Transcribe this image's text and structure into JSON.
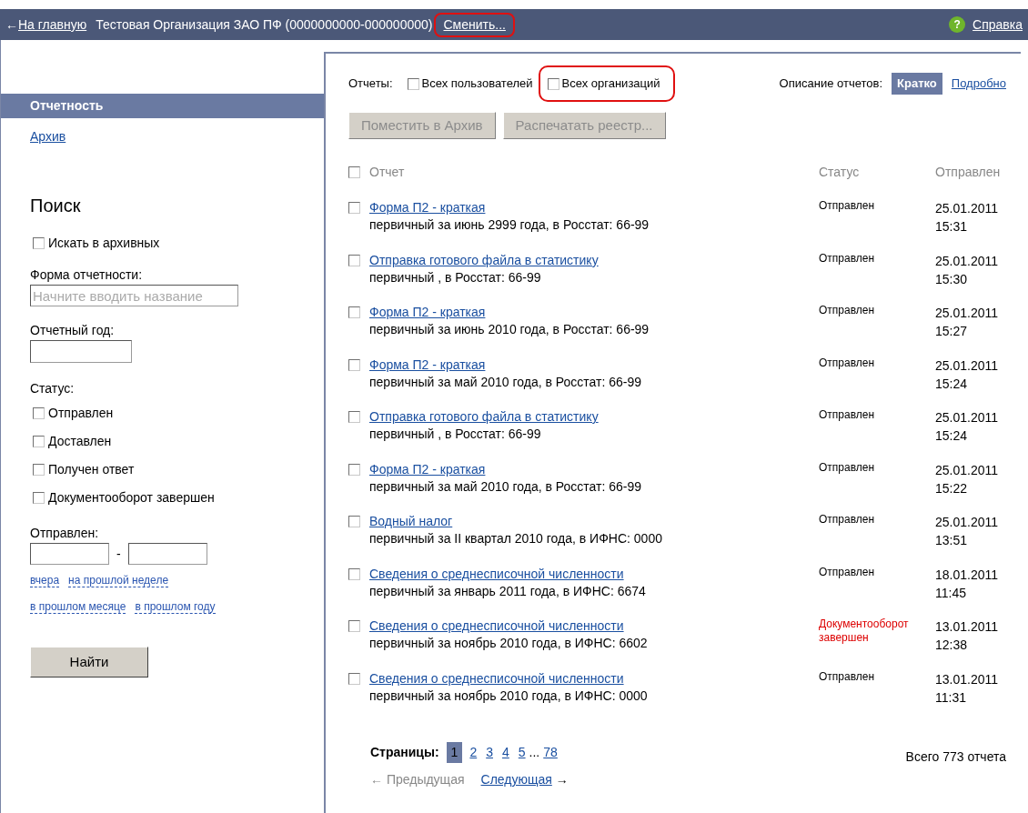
{
  "top_bar": {
    "home_link": "На главную",
    "home_arrow": "←",
    "organization": "Тестовая Организация ЗАО ПФ (0000000000-000000000)",
    "change_link": "Сменить...",
    "help_icon": "?",
    "help_link": "Справка"
  },
  "sidebar": {
    "items": [
      {
        "label": "Отчетность",
        "selected": true
      },
      {
        "label": "Архив",
        "selected": false
      }
    ]
  },
  "search": {
    "title": "Поиск",
    "archive_checkbox": {
      "label": "Искать в архивных",
      "checked": false
    },
    "form_label": "Форма отчетности:",
    "form_placeholder": "Начните вводить название",
    "year_label": "Отчетный год:",
    "status_label": "Статус:",
    "statuses": [
      {
        "label": "Отправлен",
        "checked": false
      },
      {
        "label": "Доставлен",
        "checked": false
      },
      {
        "label": "Получен ответ",
        "checked": false
      },
      {
        "label": "Документооборот завершен",
        "checked": false
      }
    ],
    "sent_label": "Отправлен:",
    "range_dash": "-",
    "quick_links": [
      [
        "вчера",
        "на прошлой неделе"
      ],
      [
        "в прошлом месяце",
        "в прошлом году"
      ]
    ],
    "find_button": "Найти"
  },
  "filters": {
    "label": "Отчеты:",
    "options": [
      {
        "label": "Всех пользователей",
        "checked": false,
        "highlighted": false
      },
      {
        "label": "Всех организаций",
        "checked": false,
        "highlighted": true
      }
    ],
    "description_label": "Описание отчетов:",
    "modes": [
      {
        "label": "Кратко",
        "selected": true
      },
      {
        "label": "Подробно",
        "selected": false
      }
    ]
  },
  "actions": [
    {
      "label": "Поместить в Архив",
      "disabled": true
    },
    {
      "label": "Распечатать реестр...",
      "disabled": true
    }
  ],
  "table": {
    "select_all": {
      "checked": false
    },
    "columns": [
      "Отчет",
      "Статус",
      "Отправлен"
    ],
    "rows": [
      {
        "checked": false,
        "title": "Форма П2 - краткая",
        "details": "первичный за июнь 2999 года, в Росстат: 66-99",
        "status": "Отправлен",
        "color": "#000000",
        "date": "25.01.2011",
        "time": "15:31"
      },
      {
        "checked": false,
        "title": "Отправка готового файла в статистику",
        "details": "первичный , в Росстат: 66-99",
        "status": "Отправлен",
        "color": "#000000",
        "date": "25.01.2011",
        "time": "15:30"
      },
      {
        "checked": false,
        "title": "Форма П2 - краткая",
        "details": "первичный за июнь 2010 года, в Росстат: 66-99",
        "status": "Отправлен",
        "color": "#000000",
        "date": "25.01.2011",
        "time": "15:27"
      },
      {
        "checked": false,
        "title": "Форма П2 - краткая",
        "details": "первичный за май 2010 года, в Росстат: 66-99",
        "status": "Отправлен",
        "color": "#000000",
        "date": "25.01.2011",
        "time": "15:24"
      },
      {
        "checked": false,
        "title": "Отправка готового файла в статистику",
        "details": "первичный , в Росстат: 66-99",
        "status": "Отправлен",
        "color": "#000000",
        "date": "25.01.2011",
        "time": "15:24"
      },
      {
        "checked": false,
        "title": "Форма П2 - краткая",
        "details": "первичный за май 2010 года, в Росстат: 66-99",
        "status": "Отправлен",
        "color": "#000000",
        "date": "25.01.2011",
        "time": "15:22"
      },
      {
        "checked": false,
        "title": "Водный налог",
        "details": "первичный за II квартал 2010 года, в ИФНС: 0000",
        "status": "Отправлен",
        "color": "#000000",
        "date": "25.01.2011",
        "time": "13:51"
      },
      {
        "checked": false,
        "title": "Сведения о среднесписочной численности",
        "details": "первичный за январь 2011 года, в ИФНС: 6674",
        "status": "Отправлен",
        "color": "#000000",
        "date": "18.01.2011",
        "time": "11:45"
      },
      {
        "checked": false,
        "title": "Сведения о среднесписочной численности",
        "details": "первичный за ноябрь 2010 года, в ИФНС: 6602",
        "status": "Документооборот завершен",
        "color": "#dd0000",
        "date": "13.01.2011",
        "time": "12:38"
      },
      {
        "checked": false,
        "title": "Сведения о среднесписочной численности",
        "details": "первичный за ноябрь 2010 года, в ИФНС: 0000",
        "status": "Отправлен",
        "color": "#000000",
        "date": "13.01.2011",
        "time": "11:31"
      }
    ]
  },
  "pagination": {
    "label": "Страницы:",
    "pages": [
      {
        "label": "1",
        "selected": true
      },
      {
        "label": "2",
        "selected": false
      },
      {
        "label": "3",
        "selected": false
      },
      {
        "label": "4",
        "selected": false
      },
      {
        "label": "5",
        "selected": false
      }
    ],
    "ellipsis": "...",
    "last_page": "78",
    "previous": {
      "label": "← Предыдущая",
      "disabled": true
    },
    "next": {
      "label": "Следующая",
      "arrow": "→",
      "disabled": false
    },
    "total": "Всего 773 отчета"
  }
}
